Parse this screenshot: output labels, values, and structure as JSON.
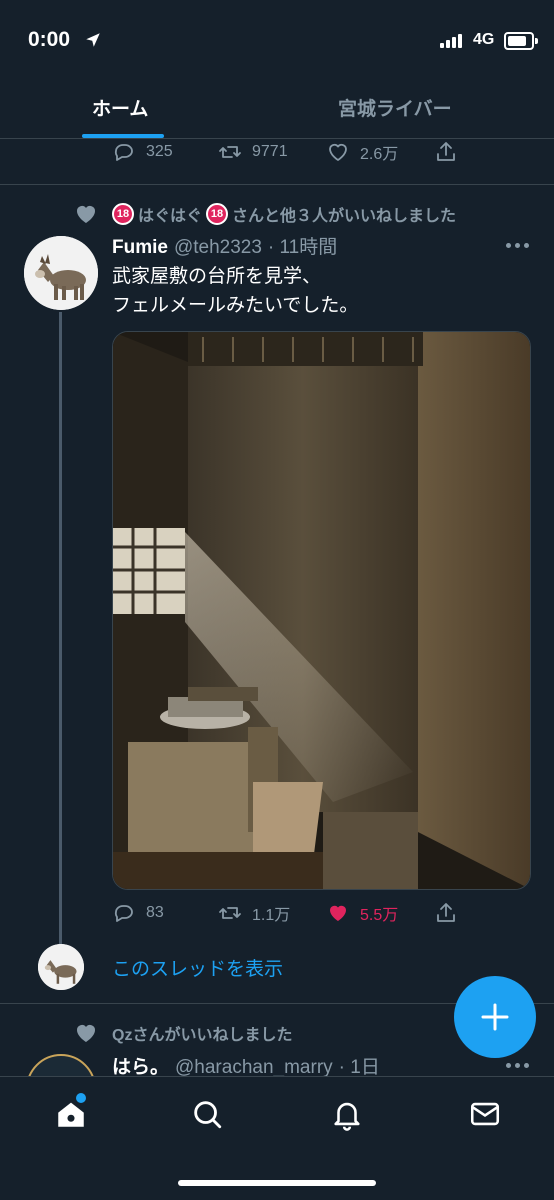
{
  "status_bar": {
    "time": "0:00",
    "network": "4G"
  },
  "tabs": [
    {
      "label": "ホーム",
      "active": true
    },
    {
      "label": "宮城ライバー",
      "active": false
    }
  ],
  "prev_tweet_actions": {
    "replies": "325",
    "retweets": "9771",
    "likes": "2.6万"
  },
  "tweet": {
    "social_context": "はぐはぐ",
    "social_context_suffix": "さんと他３人がいいねしました",
    "social_badge": "18",
    "author_name": "Fumie",
    "author_handle": "@teh2323",
    "time": "· 11時間",
    "text_line1": "武家屋敷の台所を見学、",
    "text_line2": "フェルメールみたいでした。",
    "replies": "83",
    "retweets": "1.1万",
    "likes": "5.5万",
    "liked": true,
    "show_thread_label": "このスレッドを表示"
  },
  "next_tweet": {
    "social_context": "Qzさんがいいねしました",
    "author_name": "はら。",
    "author_handle": "@harachan_marry",
    "time": "· 1日"
  },
  "colors": {
    "accent": "#1da1f2",
    "background": "#15202b",
    "like": "#e0245e",
    "muted": "#8899a6"
  },
  "icons": [
    "location-arrow-icon",
    "reply-icon",
    "retweet-icon",
    "like-icon",
    "share-icon",
    "compose-plus-icon",
    "home-icon",
    "search-icon",
    "notifications-bell-icon",
    "messages-envelope-icon"
  ]
}
